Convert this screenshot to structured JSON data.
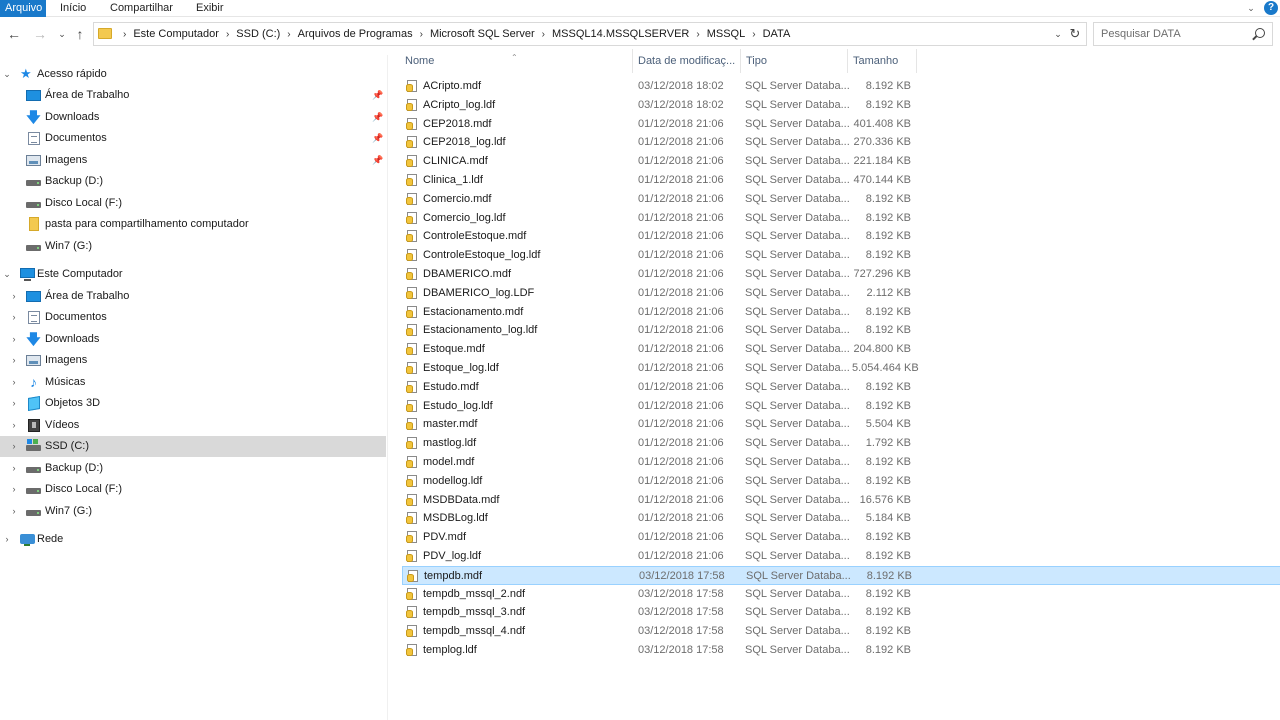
{
  "ribbon": {
    "tabs": [
      "Arquivo",
      "Início",
      "Compartilhar",
      "Exibir"
    ],
    "collapse_icon": "chevron-down-icon",
    "help_icon": "?"
  },
  "address": {
    "crumbs": [
      "Este Computador",
      "SSD (C:)",
      "Arquivos de Programas",
      "Microsoft SQL Server",
      "MSSQL14.MSSQLSERVER",
      "MSSQL",
      "DATA"
    ]
  },
  "search": {
    "placeholder": "Pesquisar DATA"
  },
  "nav": {
    "quick_access": {
      "label": "Acesso rápido",
      "items": [
        {
          "label": "Área de Trabalho",
          "icon": "desktop-icon",
          "pinned": true
        },
        {
          "label": "Downloads",
          "icon": "download-icon",
          "pinned": true
        },
        {
          "label": "Documentos",
          "icon": "document-icon",
          "pinned": true
        },
        {
          "label": "Imagens",
          "icon": "image-icon",
          "pinned": true
        },
        {
          "label": "Backup (D:)",
          "icon": "drive-icon",
          "pinned": false
        },
        {
          "label": "Disco Local (F:)",
          "icon": "drive-icon",
          "pinned": false
        },
        {
          "label": "pasta para compartilhamento computador",
          "icon": "share-folder-icon",
          "pinned": false
        },
        {
          "label": "Win7 (G:)",
          "icon": "drive-icon",
          "pinned": false
        }
      ]
    },
    "this_pc": {
      "label": "Este Computador",
      "items": [
        {
          "label": "Área de Trabalho",
          "icon": "desktop-icon"
        },
        {
          "label": "Documentos",
          "icon": "document-icon"
        },
        {
          "label": "Downloads",
          "icon": "download-icon"
        },
        {
          "label": "Imagens",
          "icon": "image-icon"
        },
        {
          "label": "Músicas",
          "icon": "music-icon"
        },
        {
          "label": "Objetos 3D",
          "icon": "3d-objects-icon"
        },
        {
          "label": "Vídeos",
          "icon": "video-icon"
        },
        {
          "label": "SSD (C:)",
          "icon": "ssd-drive-icon",
          "selected": true
        },
        {
          "label": "Backup (D:)",
          "icon": "drive-icon"
        },
        {
          "label": "Disco Local (F:)",
          "icon": "drive-icon"
        },
        {
          "label": "Win7 (G:)",
          "icon": "drive-icon"
        }
      ]
    },
    "network": {
      "label": "Rede",
      "icon": "network-icon"
    }
  },
  "columns": {
    "name": "Nome",
    "date": "Data de modificaç...",
    "type": "Tipo",
    "size": "Tamanho"
  },
  "files": [
    {
      "name": "ACripto.mdf",
      "date": "03/12/2018 18:02",
      "type": "SQL Server Databa...",
      "size": "8.192 KB"
    },
    {
      "name": "ACripto_log.ldf",
      "date": "03/12/2018 18:02",
      "type": "SQL Server Databa...",
      "size": "8.192 KB"
    },
    {
      "name": "CEP2018.mdf",
      "date": "01/12/2018 21:06",
      "type": "SQL Server Databa...",
      "size": "401.408 KB"
    },
    {
      "name": "CEP2018_log.ldf",
      "date": "01/12/2018 21:06",
      "type": "SQL Server Databa...",
      "size": "270.336 KB"
    },
    {
      "name": "CLINICA.mdf",
      "date": "01/12/2018 21:06",
      "type": "SQL Server Databa...",
      "size": "221.184 KB"
    },
    {
      "name": "Clinica_1.ldf",
      "date": "01/12/2018 21:06",
      "type": "SQL Server Databa...",
      "size": "470.144 KB"
    },
    {
      "name": "Comercio.mdf",
      "date": "01/12/2018 21:06",
      "type": "SQL Server Databa...",
      "size": "8.192 KB"
    },
    {
      "name": "Comercio_log.ldf",
      "date": "01/12/2018 21:06",
      "type": "SQL Server Databa...",
      "size": "8.192 KB"
    },
    {
      "name": "ControleEstoque.mdf",
      "date": "01/12/2018 21:06",
      "type": "SQL Server Databa...",
      "size": "8.192 KB"
    },
    {
      "name": "ControleEstoque_log.ldf",
      "date": "01/12/2018 21:06",
      "type": "SQL Server Databa...",
      "size": "8.192 KB"
    },
    {
      "name": "DBAMERICO.mdf",
      "date": "01/12/2018 21:06",
      "type": "SQL Server Databa...",
      "size": "727.296 KB"
    },
    {
      "name": "DBAMERICO_log.LDF",
      "date": "01/12/2018 21:06",
      "type": "SQL Server Databa...",
      "size": "2.112 KB"
    },
    {
      "name": "Estacionamento.mdf",
      "date": "01/12/2018 21:06",
      "type": "SQL Server Databa...",
      "size": "8.192 KB"
    },
    {
      "name": "Estacionamento_log.ldf",
      "date": "01/12/2018 21:06",
      "type": "SQL Server Databa...",
      "size": "8.192 KB"
    },
    {
      "name": "Estoque.mdf",
      "date": "01/12/2018 21:06",
      "type": "SQL Server Databa...",
      "size": "204.800 KB"
    },
    {
      "name": "Estoque_log.ldf",
      "date": "01/12/2018 21:06",
      "type": "SQL Server Databa...",
      "size": "5.054.464 KB"
    },
    {
      "name": "Estudo.mdf",
      "date": "01/12/2018 21:06",
      "type": "SQL Server Databa...",
      "size": "8.192 KB"
    },
    {
      "name": "Estudo_log.ldf",
      "date": "01/12/2018 21:06",
      "type": "SQL Server Databa...",
      "size": "8.192 KB"
    },
    {
      "name": "master.mdf",
      "date": "01/12/2018 21:06",
      "type": "SQL Server Databa...",
      "size": "5.504 KB"
    },
    {
      "name": "mastlog.ldf",
      "date": "01/12/2018 21:06",
      "type": "SQL Server Databa...",
      "size": "1.792 KB"
    },
    {
      "name": "model.mdf",
      "date": "01/12/2018 21:06",
      "type": "SQL Server Databa...",
      "size": "8.192 KB"
    },
    {
      "name": "modellog.ldf",
      "date": "01/12/2018 21:06",
      "type": "SQL Server Databa...",
      "size": "8.192 KB"
    },
    {
      "name": "MSDBData.mdf",
      "date": "01/12/2018 21:06",
      "type": "SQL Server Databa...",
      "size": "16.576 KB"
    },
    {
      "name": "MSDBLog.ldf",
      "date": "01/12/2018 21:06",
      "type": "SQL Server Databa...",
      "size": "5.184 KB"
    },
    {
      "name": "PDV.mdf",
      "date": "01/12/2018 21:06",
      "type": "SQL Server Databa...",
      "size": "8.192 KB"
    },
    {
      "name": "PDV_log.ldf",
      "date": "01/12/2018 21:06",
      "type": "SQL Server Databa...",
      "size": "8.192 KB"
    },
    {
      "name": "tempdb.mdf",
      "date": "03/12/2018 17:58",
      "type": "SQL Server Databa...",
      "size": "8.192 KB",
      "selected": true
    },
    {
      "name": "tempdb_mssql_2.ndf",
      "date": "03/12/2018 17:58",
      "type": "SQL Server Databa...",
      "size": "8.192 KB"
    },
    {
      "name": "tempdb_mssql_3.ndf",
      "date": "03/12/2018 17:58",
      "type": "SQL Server Databa...",
      "size": "8.192 KB"
    },
    {
      "name": "tempdb_mssql_4.ndf",
      "date": "03/12/2018 17:58",
      "type": "SQL Server Databa...",
      "size": "8.192 KB"
    },
    {
      "name": "templog.ldf",
      "date": "03/12/2018 17:58",
      "type": "SQL Server Databa...",
      "size": "8.192 KB"
    }
  ]
}
